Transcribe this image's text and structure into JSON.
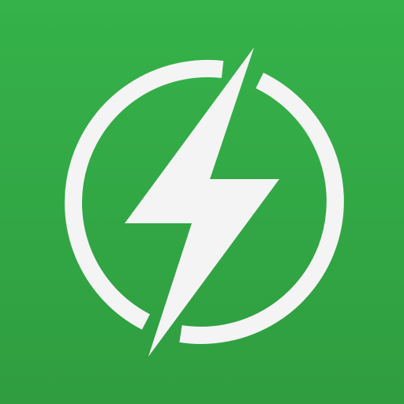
{
  "icon": {
    "name": "lightning-bolt-power-icon",
    "colors": {
      "background_top": "#35b24a",
      "background_bottom": "#2f9d40",
      "foreground": "#f4f4f4"
    }
  }
}
